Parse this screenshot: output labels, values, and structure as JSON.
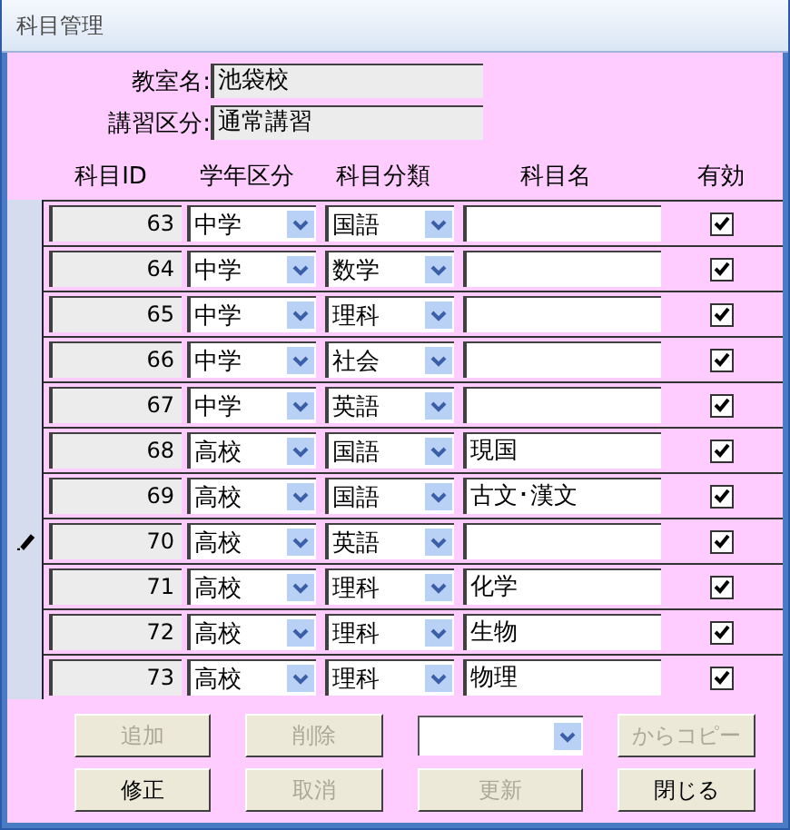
{
  "window": {
    "title": "科目管理"
  },
  "header_fields": [
    {
      "label": "教室名:",
      "value": "池袋校"
    },
    {
      "label": "講習区分:",
      "value": "通常講習"
    }
  ],
  "columns": [
    "科目ID",
    "学年区分",
    "科目分類",
    "科目名",
    "有効"
  ],
  "rows": [
    {
      "id": "63",
      "grade": "中学",
      "category": "国語",
      "name": "",
      "active": true,
      "editing": false
    },
    {
      "id": "64",
      "grade": "中学",
      "category": "数学",
      "name": "",
      "active": true,
      "editing": false
    },
    {
      "id": "65",
      "grade": "中学",
      "category": "理科",
      "name": "",
      "active": true,
      "editing": false
    },
    {
      "id": "66",
      "grade": "中学",
      "category": "社会",
      "name": "",
      "active": true,
      "editing": false
    },
    {
      "id": "67",
      "grade": "中学",
      "category": "英語",
      "name": "",
      "active": true,
      "editing": false
    },
    {
      "id": "68",
      "grade": "高校",
      "category": "国語",
      "name": "現国",
      "active": true,
      "editing": false
    },
    {
      "id": "69",
      "grade": "高校",
      "category": "国語",
      "name": "古文･漢文",
      "active": true,
      "editing": false
    },
    {
      "id": "70",
      "grade": "高校",
      "category": "英語",
      "name": "",
      "active": true,
      "editing": true
    },
    {
      "id": "71",
      "grade": "高校",
      "category": "理科",
      "name": "化学",
      "active": true,
      "editing": false
    },
    {
      "id": "72",
      "grade": "高校",
      "category": "理科",
      "name": "生物",
      "active": true,
      "editing": false
    },
    {
      "id": "73",
      "grade": "高校",
      "category": "理科",
      "name": "物理",
      "active": true,
      "editing": false
    }
  ],
  "actions": [
    {
      "kind": "button",
      "label": "追加",
      "disabled": true
    },
    {
      "kind": "button",
      "label": "削除",
      "disabled": true
    },
    {
      "kind": "picker"
    },
    {
      "kind": "button",
      "label": "からコピー",
      "disabled": true
    },
    {
      "kind": "button",
      "label": "修正",
      "disabled": false
    },
    {
      "kind": "button",
      "label": "取消",
      "disabled": true
    },
    {
      "kind": "button",
      "label": "更新",
      "disabled": true
    },
    {
      "kind": "button",
      "label": "閉じる",
      "disabled": false
    }
  ]
}
